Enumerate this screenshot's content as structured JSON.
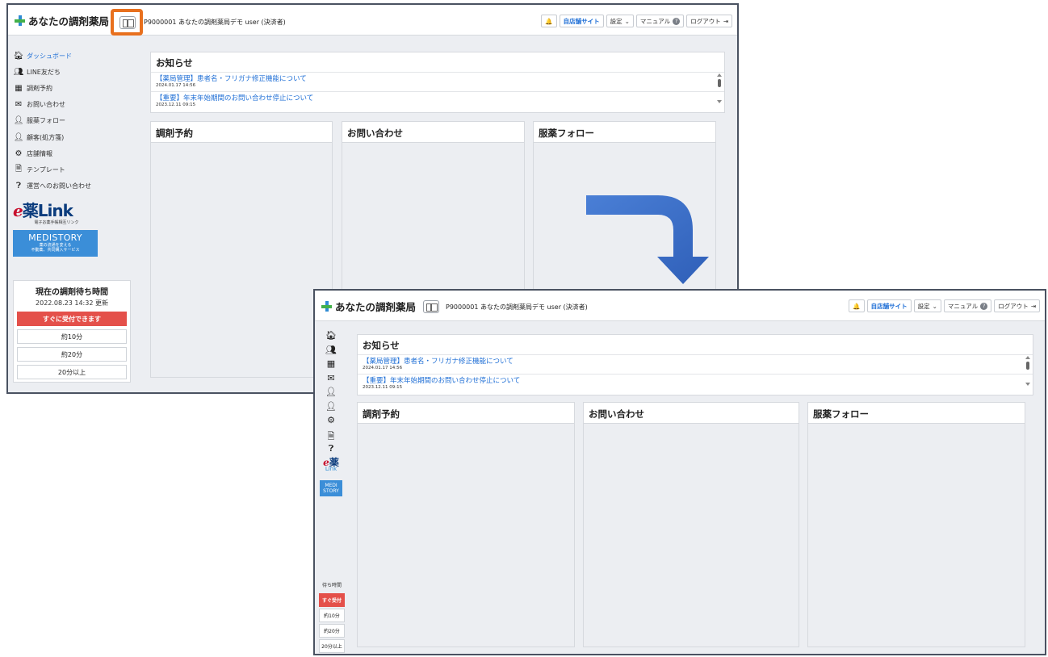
{
  "app": {
    "title": "あなたの調剤薬局",
    "store": "P9000001 あなたの調剤薬局デモ user (決済者)",
    "buttons": {
      "site": "自店舗サイト",
      "settings": "設定",
      "manual": "マニュアル",
      "logout": "ログアウト"
    }
  },
  "sidebar": {
    "items": [
      {
        "label": "ダッシュボード",
        "icon": "home-icon"
      },
      {
        "label": "LINE友だち",
        "icon": "users-icon"
      },
      {
        "label": "調剤予約",
        "icon": "calendar-icon"
      },
      {
        "label": "お問い合わせ",
        "icon": "mail-icon"
      },
      {
        "label": "服薬フォロー",
        "icon": "pharmacist-icon"
      },
      {
        "label": "顧客(処方箋)",
        "icon": "customer-icon"
      },
      {
        "label": "店舗情報",
        "icon": "gear-icon"
      },
      {
        "label": "テンプレート",
        "icon": "document-icon"
      },
      {
        "label": "運営へのお問い合わせ",
        "icon": "help-icon"
      }
    ],
    "elink_logo": {
      "e": "e",
      "kanji": "薬",
      "link": "Link",
      "sub": "電子お薬手帳相互リンク"
    },
    "medistory": {
      "title": "MEDISTORY",
      "sub1": "薬の流通を変える",
      "sub2": "不動薬、共同購入サービス"
    }
  },
  "wait": {
    "title": "現在の調剤待ち時間",
    "updated": "2022.08.23 14:32 更新",
    "now_label": "すぐに受付できます",
    "options": [
      "約10分",
      "約20分",
      "20分以上"
    ]
  },
  "mini_sidebar": {
    "medistory": "MEDI STORY",
    "wait_title": "待ち時間",
    "now_label": "すぐ受付"
  },
  "notices": {
    "title": "お知らせ",
    "items": [
      {
        "text": "【薬局管理】患者名・フリガナ修正機能について",
        "date": "2024.01.17 14:56"
      },
      {
        "text": "【重要】年末年始期間のお問い合わせ停止について",
        "date": "2023.12.11 09:15"
      }
    ]
  },
  "panels": [
    "調剤予約",
    "お問い合わせ",
    "服薬フォロー"
  ],
  "colors": {
    "accent": "#1f6fd6",
    "danger": "#e4504a",
    "highlight": "#e8701e",
    "arrow": "#3d6fc9"
  }
}
